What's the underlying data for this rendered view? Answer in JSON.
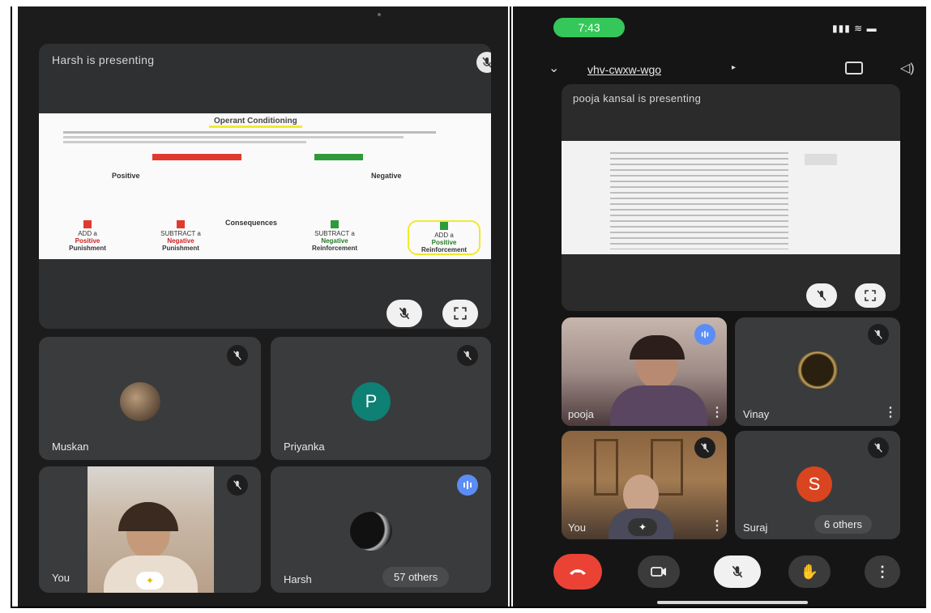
{
  "left_call": {
    "presenting_title": "Harsh is presenting",
    "participants": [
      {
        "name": "Muskan"
      },
      {
        "name": "Priyanka",
        "initial": "P"
      },
      {
        "name": "You"
      },
      {
        "name": "Harsh"
      }
    ],
    "others_badge": "57 others",
    "slide": {
      "heading": "Operant Conditioning",
      "left_node": "Positive",
      "right_node": "Negative",
      "middle_label": "Consequences",
      "outcomes": [
        {
          "top": "ADD a",
          "mid": "Positive",
          "bottom": "Punishment"
        },
        {
          "top": "SUBTRACT a",
          "mid": "Negative",
          "bottom": "Punishment"
        },
        {
          "top": "SUBTRACT a",
          "mid": "Negative",
          "bottom": "Reinforcement"
        },
        {
          "top": "ADD a",
          "mid": "Positive",
          "bottom": "Reinforcement"
        }
      ]
    }
  },
  "right_call": {
    "status_time": "7:43",
    "meeting_code": "vhv-cwxw-wgo",
    "presenting_title": "pooja kansal is presenting",
    "participants": [
      {
        "name": "pooja"
      },
      {
        "name": "Vinay"
      },
      {
        "name": "You"
      },
      {
        "name": "Suraj",
        "initial": "S"
      }
    ],
    "others_badge": "6 others"
  },
  "colors": {
    "meet_dark": "#1c1c1d",
    "tile": "#3a3b3c",
    "priyanka_avatar": "#0e8074",
    "suraj_avatar": "#d9451f",
    "status_green": "#35c759",
    "end_call_red": "#ea4335",
    "speaking_blue": "#5c8df6"
  }
}
